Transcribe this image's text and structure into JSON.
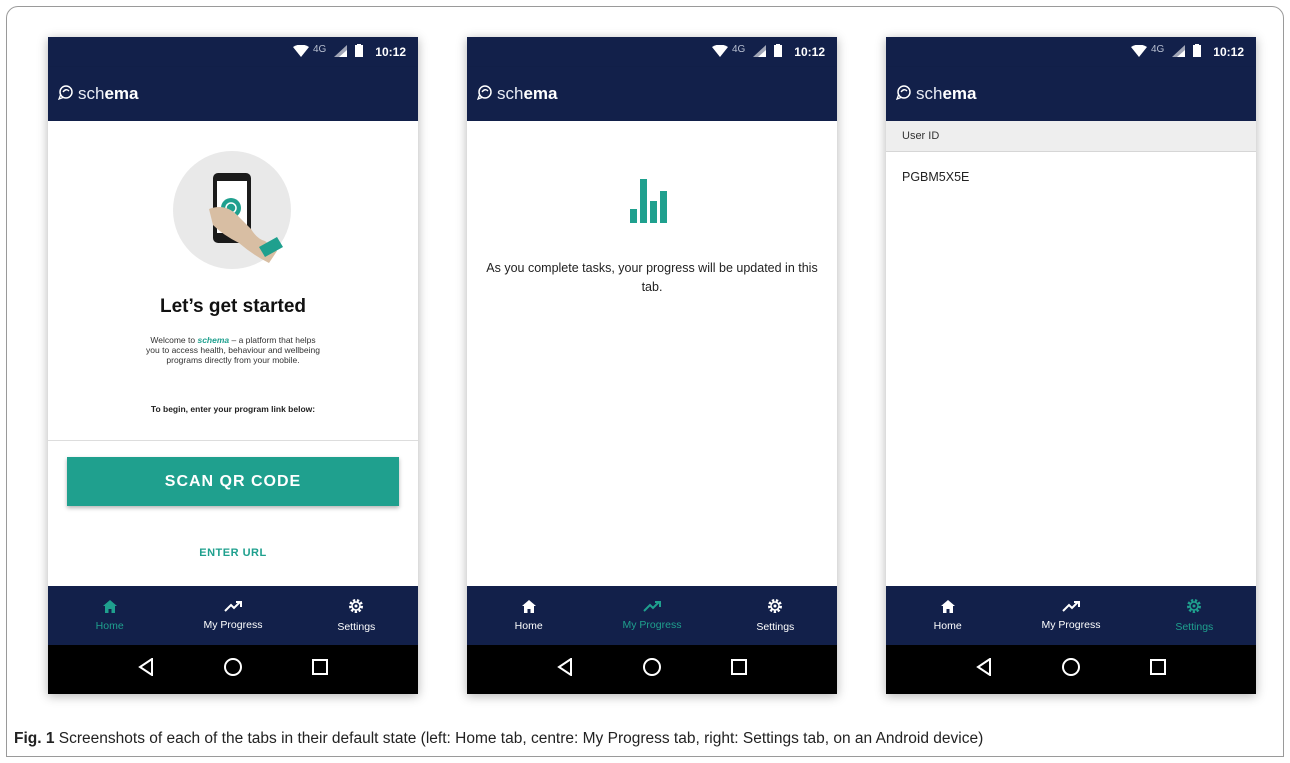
{
  "statusbar": {
    "network": "4G",
    "time": "10:12"
  },
  "brand": {
    "part1": "sch",
    "part2": "ema"
  },
  "nav": {
    "home": "Home",
    "progress": "My Progress",
    "settings": "Settings"
  },
  "home": {
    "title": "Let’s get started",
    "desc_pre": "Welcome to ",
    "desc_brand": "schema",
    "desc_post": " – a platform that helps you to access health, behaviour and wellbeing programs directly from your mobile.",
    "instruction": "To begin, enter your program link below:",
    "scan_button": "SCAN QR CODE",
    "enter_url": "ENTER URL"
  },
  "progress": {
    "message": "As you complete tasks, your progress will be updated in this tab."
  },
  "settings": {
    "section": "User ID",
    "user_id": "PGBM5X5E"
  },
  "caption": {
    "label": "Fig. 1",
    "text": " Screenshots of each of the tabs in their default state (left: Home tab, centre: My Progress tab, right: Settings tab, on an Android device)"
  },
  "colors": {
    "navy": "#12204a",
    "teal": "#1fa08e"
  },
  "active_tabs": [
    "home",
    "progress",
    "settings"
  ]
}
